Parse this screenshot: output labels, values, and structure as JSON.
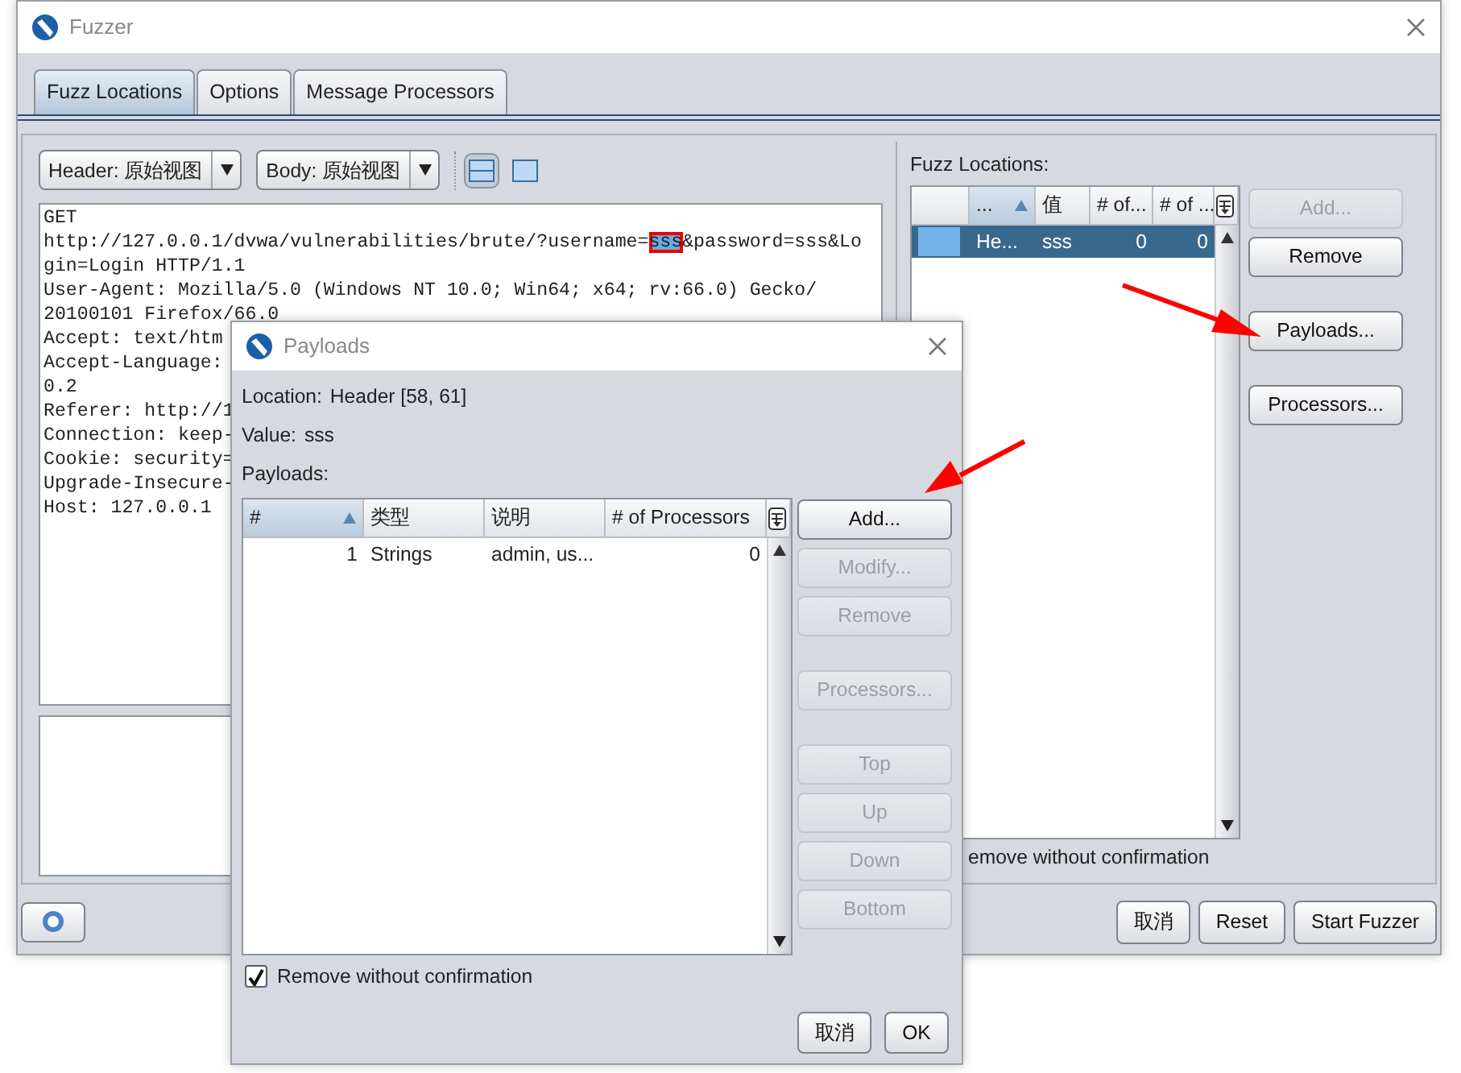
{
  "fuzzer": {
    "title": "Fuzzer",
    "tabs": [
      {
        "label": "Fuzz Locations",
        "selected": true
      },
      {
        "label": "Options",
        "selected": false
      },
      {
        "label": "Message Processors",
        "selected": false
      }
    ],
    "header_view": "Header: 原始视图",
    "body_view": "Body: 原始视图",
    "view_toggles": [
      {
        "selected": true
      },
      {
        "selected": false
      }
    ],
    "request_lines": [
      {
        "segments": [
          {
            "text": "GET",
            "marked": false
          }
        ]
      },
      {
        "segments": [
          {
            "text": "http://127.0.0.1/dvwa/vulnerabilities/brute/?username=",
            "marked": false
          },
          {
            "text": "sss",
            "marked": true
          },
          {
            "text": "&password=sss&Lo",
            "marked": false
          }
        ]
      },
      {
        "segments": [
          {
            "text": "gin=Login HTTP/1.1",
            "marked": false
          }
        ]
      },
      {
        "segments": [
          {
            "text": "User-Agent: Mozilla/5.0 (Windows NT 10.0; Win64; x64; rv:66.0) Gecko/",
            "marked": false
          }
        ]
      },
      {
        "segments": [
          {
            "text": "20100101 Firefox/66.0",
            "marked": false
          }
        ]
      },
      {
        "segments": [
          {
            "text": "Accept: text/htm",
            "marked": false
          }
        ]
      },
      {
        "segments": [
          {
            "text": "Accept-Language:",
            "marked": false
          }
        ]
      },
      {
        "segments": [
          {
            "text": "0.2",
            "marked": false
          }
        ]
      },
      {
        "segments": [
          {
            "text": "Referer: http://1",
            "marked": false
          }
        ]
      },
      {
        "segments": [
          {
            "text": "Connection: keep-",
            "marked": false
          }
        ]
      },
      {
        "segments": [
          {
            "text": "Cookie: security=",
            "marked": false
          }
        ]
      },
      {
        "segments": [
          {
            "text": "Upgrade-Insecure-",
            "marked": false
          }
        ]
      },
      {
        "segments": [
          {
            "text": "Host: 127.0.0.1",
            "marked": false
          }
        ]
      }
    ],
    "locations_label": "Fuzz Locations:",
    "location_columns": [
      {
        "sorted": false
      },
      {
        "label": "...",
        "sorted": true
      },
      {
        "label": "值",
        "sorted": false
      },
      {
        "label": "# of...",
        "sorted": false
      },
      {
        "label": "# of ...",
        "sorted": false
      }
    ],
    "location_rows": [
      {
        "selected": true,
        "color": "#74b4e8",
        "cells": [
          "He...",
          "sss",
          "0",
          "0"
        ]
      }
    ],
    "location_buttons": [
      {
        "label": "Add...",
        "disabled": true
      },
      {
        "label": "Remove",
        "disabled": false
      },
      {
        "label": "Payloads...",
        "disabled": false
      },
      {
        "label": "Processors...",
        "disabled": false
      }
    ],
    "remove_label": "emove without confirmation",
    "footer_buttons": [
      "取消",
      "Reset",
      "Start Fuzzer"
    ]
  },
  "payloads_dialog": {
    "title": "Payloads",
    "location_label": "Location:",
    "location": "Header [58, 61]",
    "value_label": "Value:",
    "value": "sss",
    "payloads_label": "Payloads:",
    "columns": [
      {
        "label": "#",
        "sorted": true
      },
      {
        "label": "类型",
        "sorted": false
      },
      {
        "label": "说明",
        "sorted": false
      },
      {
        "label": "# of Processors",
        "sorted": false
      }
    ],
    "rows": [
      {
        "selected": false,
        "cells": [
          "1",
          "Strings",
          "admin, us...",
          "0"
        ]
      }
    ],
    "buttons": [
      {
        "label": "Add...",
        "disabled": false
      },
      {
        "label": "Modify...",
        "disabled": true
      },
      {
        "label": "Remove",
        "disabled": true
      },
      {
        "label": "Processors...",
        "disabled": true
      },
      {
        "label": "Top",
        "disabled": true
      },
      {
        "label": "Up",
        "disabled": true
      },
      {
        "label": "Down",
        "disabled": true
      },
      {
        "label": "Bottom",
        "disabled": true
      }
    ],
    "remove_without_confirmation": {
      "label": "Remove without confirmation",
      "checked": true
    },
    "footer_buttons": [
      "取消",
      "OK"
    ]
  }
}
